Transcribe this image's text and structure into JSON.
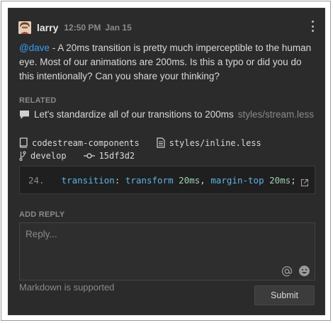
{
  "post": {
    "author": "larry",
    "time": "12:50 PM",
    "date": "Jan 15",
    "mention": "@dave",
    "text": " - A 20ms transition is pretty much imperceptible to the human eye. Most of our animations are 200ms. Is this a typo or did you do this intentionally? Can you share your thinking?"
  },
  "related": {
    "label": "RELATED",
    "title": "Let's standardize all of our transitions to 200ms",
    "file": "styles/stream.less"
  },
  "code_context": {
    "repo": "codestream-components",
    "file": "styles/inline.less",
    "branch": "develop",
    "commit": "15df3d2",
    "line_number": "24.",
    "code_property": "transition",
    "code_colon": ": ",
    "code_value1": "transform",
    "code_space1": " ",
    "code_value2": "20ms",
    "code_comma": ", ",
    "code_value3": "margin-top",
    "code_space2": " ",
    "code_value4": "20ms",
    "code_semicolon": ";"
  },
  "reply": {
    "label": "ADD REPLY",
    "placeholder": "Reply...",
    "markdown_note": "Markdown is supported",
    "submit_label": "Submit"
  },
  "icons": {
    "avatar": "avatar",
    "kebab": "kebab-menu-icon",
    "related": "comment-icon",
    "repo": "repo-icon",
    "file": "file-icon",
    "branch": "git-branch-icon",
    "commit": "git-commit-icon",
    "open_external": "external-link-icon",
    "mention": "at-sign-icon",
    "emoji": "emoji-icon"
  },
  "colors": {
    "panel_bg": "#2b2b2b",
    "mention": "#3a9cf0",
    "code_keyword": "#5fb3e6",
    "code_value": "#9ed1b3"
  }
}
